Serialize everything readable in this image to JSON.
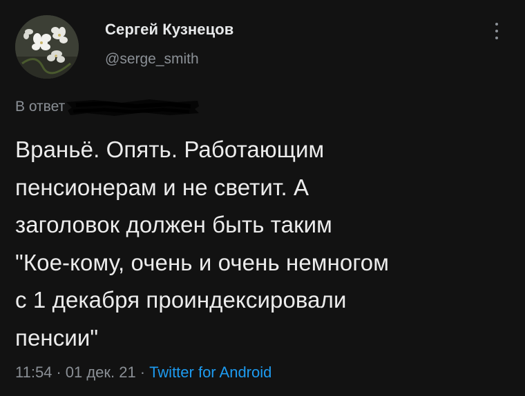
{
  "author": {
    "name": "Сергей Кузнецов",
    "handle": "@serge_smith"
  },
  "reply": {
    "label": "В ответ"
  },
  "tweet": {
    "lines": [
      "Враньё. Опять. Работающим",
      "пенсионерам и не светит. А",
      "заголовок должен быть таким",
      "\"Кое-кому, очень и очень немногом",
      "с 1 декабря проиндексировали",
      "пенсии\""
    ]
  },
  "meta": {
    "time": "11:54",
    "separator": "·",
    "date": "01 дек. 21",
    "source": "Twitter for Android"
  },
  "colors": {
    "background": "#121212",
    "text": "#e7e9ea",
    "secondary": "#8b9096",
    "link": "#1d9bf0"
  },
  "icons": {
    "more": "more-vertical-icon",
    "avatar": "flowers-avatar"
  }
}
